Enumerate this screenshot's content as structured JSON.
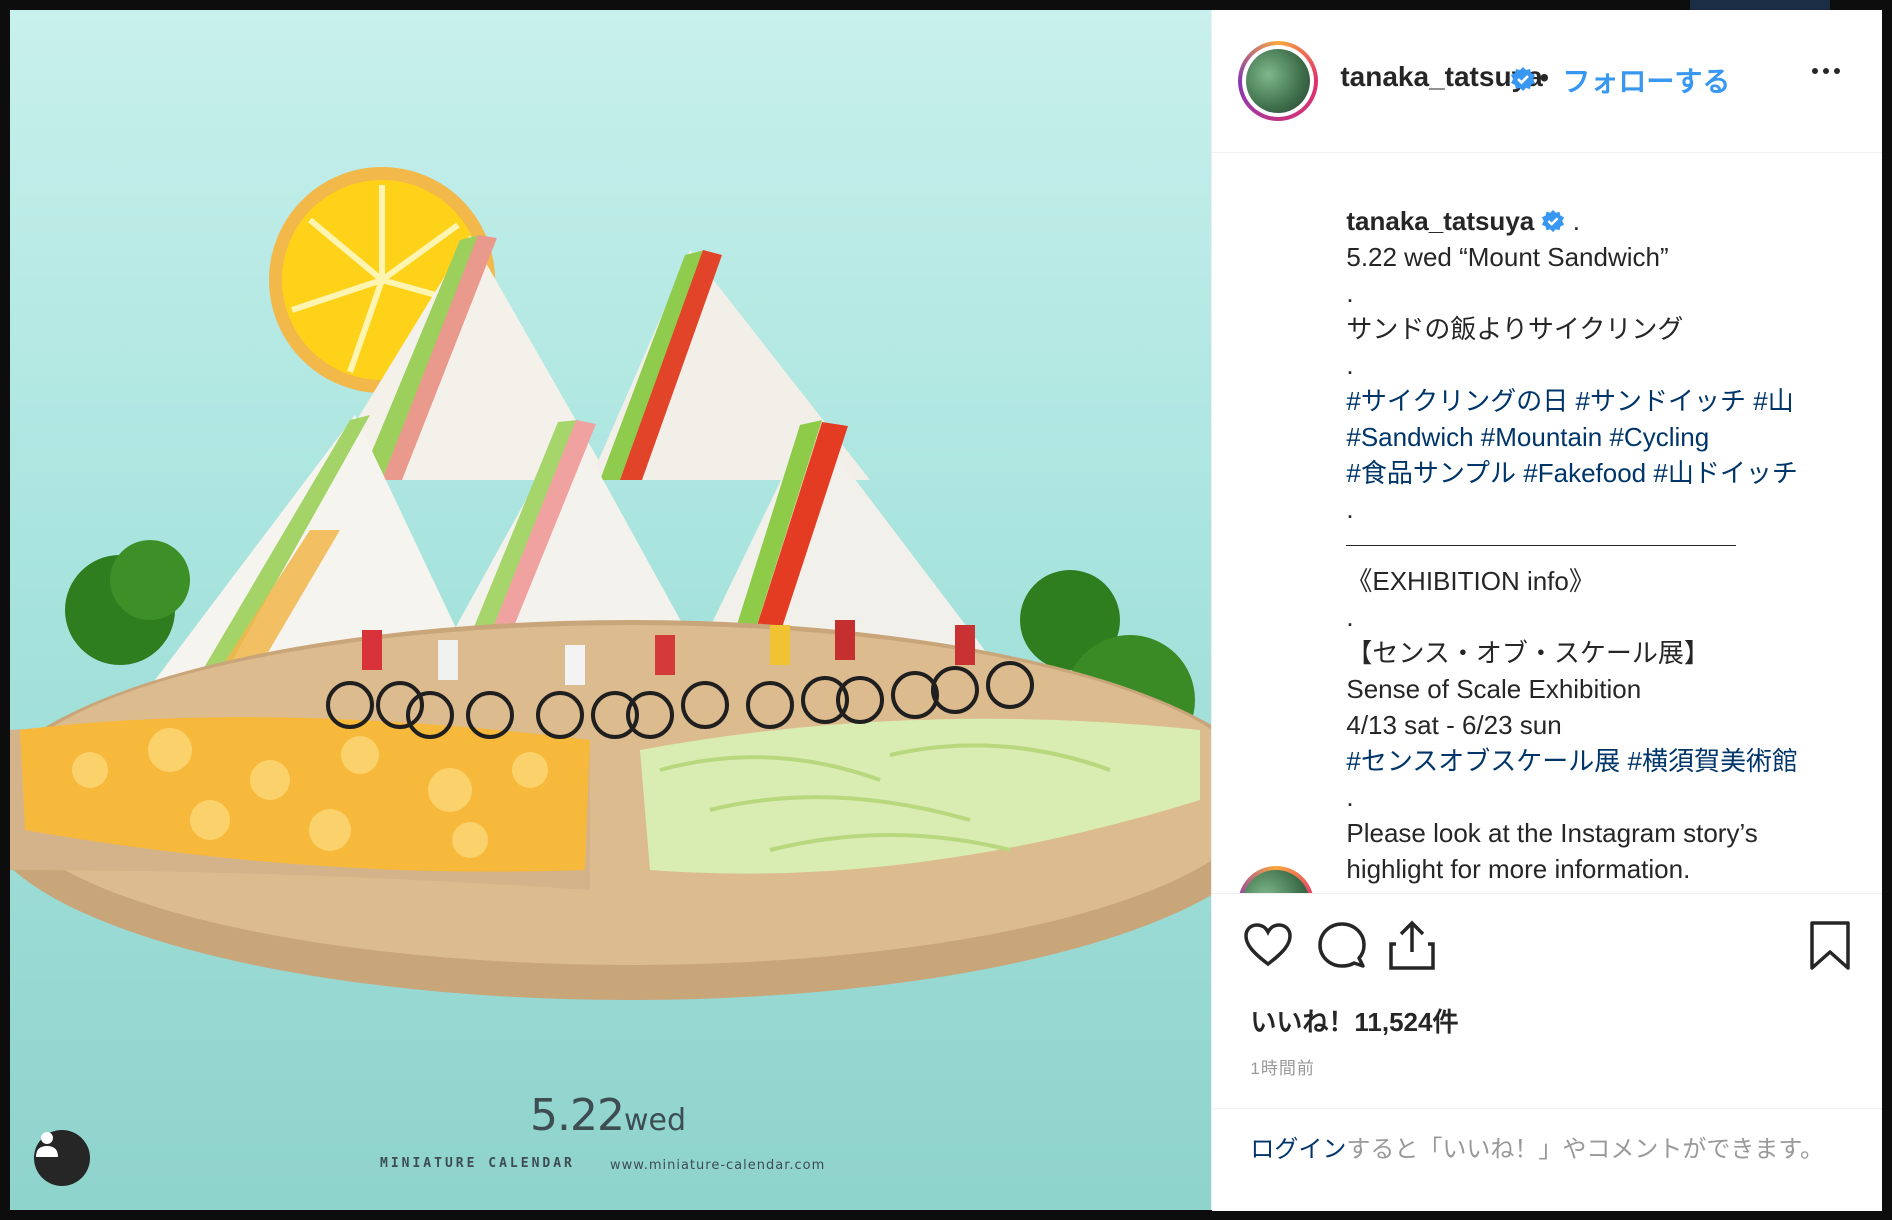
{
  "post": {
    "photo": {
      "date_number": "5.22",
      "date_day": "wed",
      "credit": "MINIATURE CALENDAR",
      "url": "www.miniature-calendar.com",
      "description_icon": "sandwich-mountain-photo"
    },
    "header": {
      "username": "tanaka_tatsuya",
      "separator": "•",
      "follow_label": "フォローする",
      "more_icon": "more-options-icon",
      "verified_icon": "verified-badge-icon"
    },
    "caption": {
      "username": "tanaka_tatsuya",
      "after_user": ".",
      "title_line": "5.22 wed “Mount Sandwich”",
      "dot1": ".",
      "line_jp": "サンドの飯よりサイクリング",
      "dot2": ".",
      "tags_line1": [
        "#サイクリングの日",
        "#サンドイッチ",
        "#山"
      ],
      "tags_line2": [
        "#Sandwich",
        "#Mountain",
        "#Cycling"
      ],
      "tags_line3": [
        "#食品サンプル",
        "#Fakefood",
        "#山ドイッチ"
      ],
      "dot3": ".",
      "exhibition_heading": "《EXHIBITION info》",
      "dot4": ".",
      "exhibition_title": "【センス・オブ・スケール展】",
      "exhibition_en": "Sense of Scale Exhibition",
      "exhibition_dates": "4/13 sat - 6/23 sun",
      "tags_line4": [
        "#センスオブスケール展",
        "#横須賀美術館"
      ],
      "dot5": ".",
      "story_line1": "Please look at the Instagram story’s",
      "story_line2": "highlight for more information."
    },
    "actions": {
      "like_icon": "heart-icon",
      "comment_icon": "comment-icon",
      "share_icon": "share-icon",
      "save_icon": "bookmark-icon",
      "likes_text": "いいね！11,524件",
      "time_text": "1時間前"
    },
    "login": {
      "link_text": "ログイン",
      "rest_text": "すると「いいね！」やコメントができます。"
    }
  },
  "colors": {
    "link_blue": "#3897f0",
    "hashtag": "#003569",
    "text": "#262626",
    "muted": "#999999"
  }
}
